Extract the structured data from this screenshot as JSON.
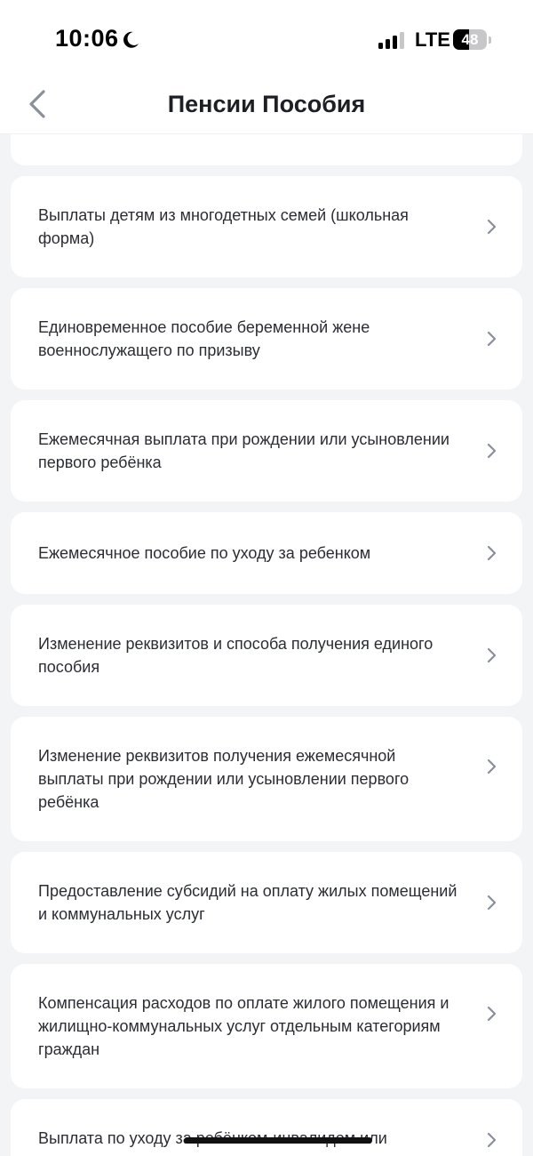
{
  "status_bar": {
    "time": "10:06",
    "network": "LTE",
    "battery_level": "48",
    "battery_fraction": 0.48
  },
  "header": {
    "title": "Пенсии Пособия",
    "back_icon": "chevron-left-icon"
  },
  "services": [
    {
      "label": "Выплаты детям из многодетных семей (школьная форма)"
    },
    {
      "label": "Единовременное пособие беременной жене военнослужащего по призыву"
    },
    {
      "label": "Ежемесячная выплата при рождении или усыновлении первого ребёнка"
    },
    {
      "label": "Ежемесячное пособие по уходу за ребенком"
    },
    {
      "label": "Изменение реквизитов и способа получения единого пособия"
    },
    {
      "label": "Изменение реквизитов получения ежемесячной выплаты при рождении или усыновлении первого ребёнка"
    },
    {
      "label": "Предоставление субсидий на оплату жилых помещений и коммунальных услуг"
    },
    {
      "label": "Компенсация расходов по оплате жилого помещения и жилищно-коммунальных услуг отдельным категориям граждан"
    },
    {
      "label": "Выплата по уходу за ребёнком-инвалидом или"
    }
  ],
  "colors": {
    "background": "#f3f4f6",
    "card": "#ffffff",
    "text": "#2b2d33",
    "chevron": "#8a8f99"
  }
}
